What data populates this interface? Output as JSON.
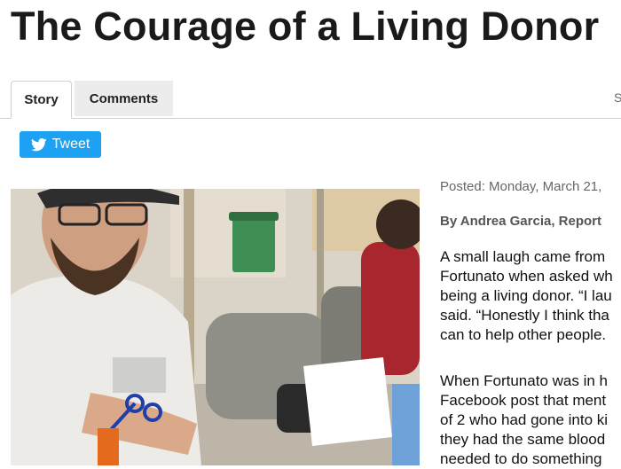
{
  "article": {
    "title": "The Courage of a Living Donor"
  },
  "tabs": {
    "story_label": "Story",
    "comments_label": "Comments",
    "right_label": "S"
  },
  "share": {
    "tweet_label": "Tweet"
  },
  "meta": {
    "posted": "Posted: Monday, March 21,",
    "author": "By Andrea Garcia, Report"
  },
  "body": {
    "para1": [
      "A small laugh came from",
      "Fortunato when asked wh",
      "being a living donor. “I lau",
      "said. “Honestly I think tha",
      "can to help other people."
    ],
    "para2": [
      "When Fortunato was in h",
      "Facebook post that ment",
      "of 2 who had gone into ki",
      "they had the same blood",
      "needed to do something"
    ]
  },
  "colors": {
    "tweet_blue": "#1da1f2",
    "tab_inactive_bg": "#ececec"
  }
}
